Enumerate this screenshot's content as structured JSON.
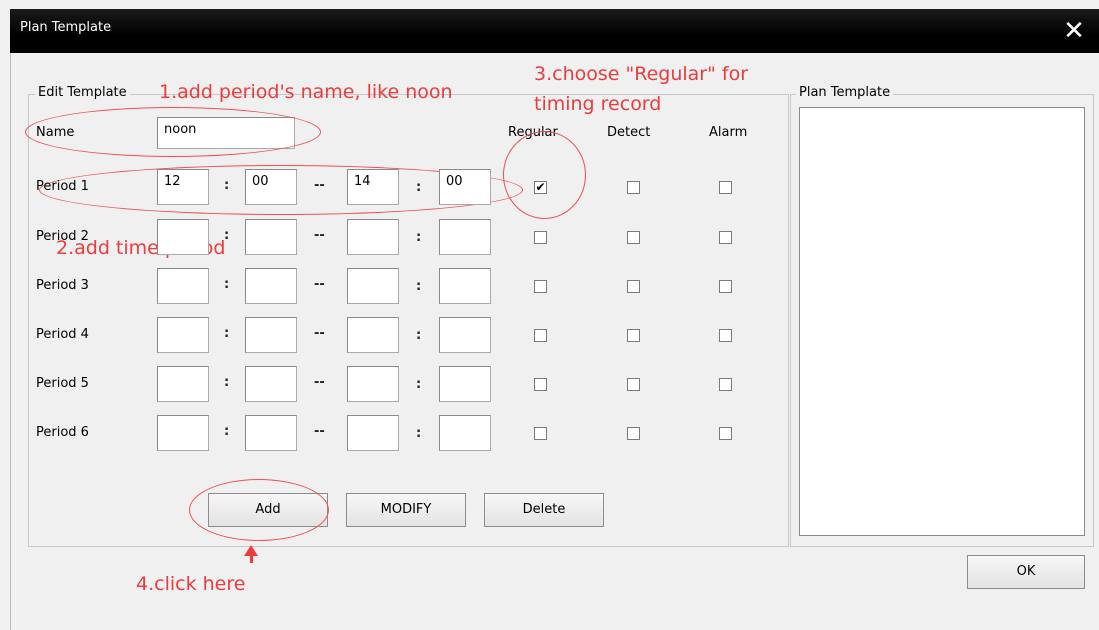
{
  "window": {
    "title": "Plan Template",
    "close_icon": "close-icon",
    "close_glyph": "✕"
  },
  "edit_group": {
    "legend": "Edit Template",
    "name_label": "Name",
    "name_value": "noon",
    "col_regular": "Regular",
    "col_detect": "Detect",
    "col_alarm": "Alarm",
    "colon": ":",
    "dash": "--",
    "periods": [
      {
        "label": "Period 1",
        "start_h": "12",
        "start_m": "00",
        "end_h": "14",
        "end_m": "00",
        "regular": true,
        "detect": false,
        "alarm": false
      },
      {
        "label": "Period 2",
        "start_h": "",
        "start_m": "",
        "end_h": "",
        "end_m": "",
        "regular": false,
        "detect": false,
        "alarm": false
      },
      {
        "label": "Period 3",
        "start_h": "",
        "start_m": "",
        "end_h": "",
        "end_m": "",
        "regular": false,
        "detect": false,
        "alarm": false
      },
      {
        "label": "Period 4",
        "start_h": "",
        "start_m": "",
        "end_h": "",
        "end_m": "",
        "regular": false,
        "detect": false,
        "alarm": false
      },
      {
        "label": "Period 5",
        "start_h": "",
        "start_m": "",
        "end_h": "",
        "end_m": "",
        "regular": false,
        "detect": false,
        "alarm": false
      },
      {
        "label": "Period 6",
        "start_h": "",
        "start_m": "",
        "end_h": "",
        "end_m": "",
        "regular": false,
        "detect": false,
        "alarm": false
      }
    ],
    "buttons": {
      "add": "Add",
      "modify": "MODIFY",
      "delete": "Delete"
    }
  },
  "plan_group": {
    "legend": "Plan Template",
    "items": []
  },
  "ok_button": "OK",
  "annotations": {
    "step1": "1.add period's name, like noon",
    "step2": "2.add time period",
    "step3_line1": "3.choose \"Regular\" for",
    "step3_line2": "timing record",
    "step4": "4.click here",
    "color": "#ee3b3b"
  }
}
